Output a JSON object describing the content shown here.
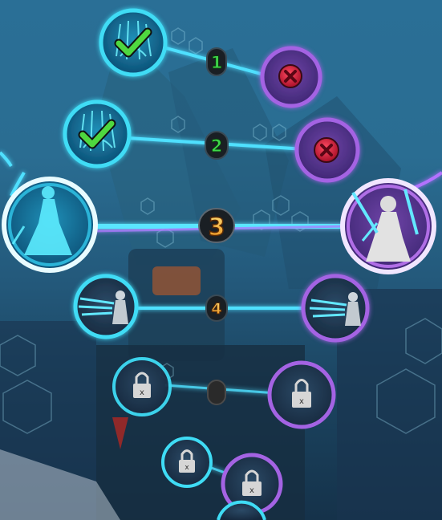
{
  "screen": "bracket-progress",
  "stages": [
    {
      "number": "1",
      "state": "won",
      "player": "won",
      "opponent": "lost"
    },
    {
      "number": "2",
      "state": "won",
      "player": "won",
      "opponent": "lost"
    },
    {
      "number": "3",
      "state": "current",
      "player": "current",
      "opponent": "current"
    },
    {
      "number": "4",
      "state": "next",
      "player": "open",
      "opponent": "open"
    },
    {
      "number": "",
      "state": "locked",
      "player": "locked",
      "opponent": "locked"
    },
    {
      "number": "",
      "state": "locked",
      "player": "locked",
      "opponent": "locked"
    }
  ],
  "lock_mark": "x",
  "colors": {
    "cyan": "#33d8f2",
    "purple": "#a05ad8",
    "green": "#3ec83c",
    "red": "#e0223c",
    "gold": "#f3b522"
  },
  "icons": [
    "checkmark-icon",
    "x-mark-icon",
    "padlock-icon",
    "ice-warrior-icon",
    "dress-fighter-icon"
  ]
}
